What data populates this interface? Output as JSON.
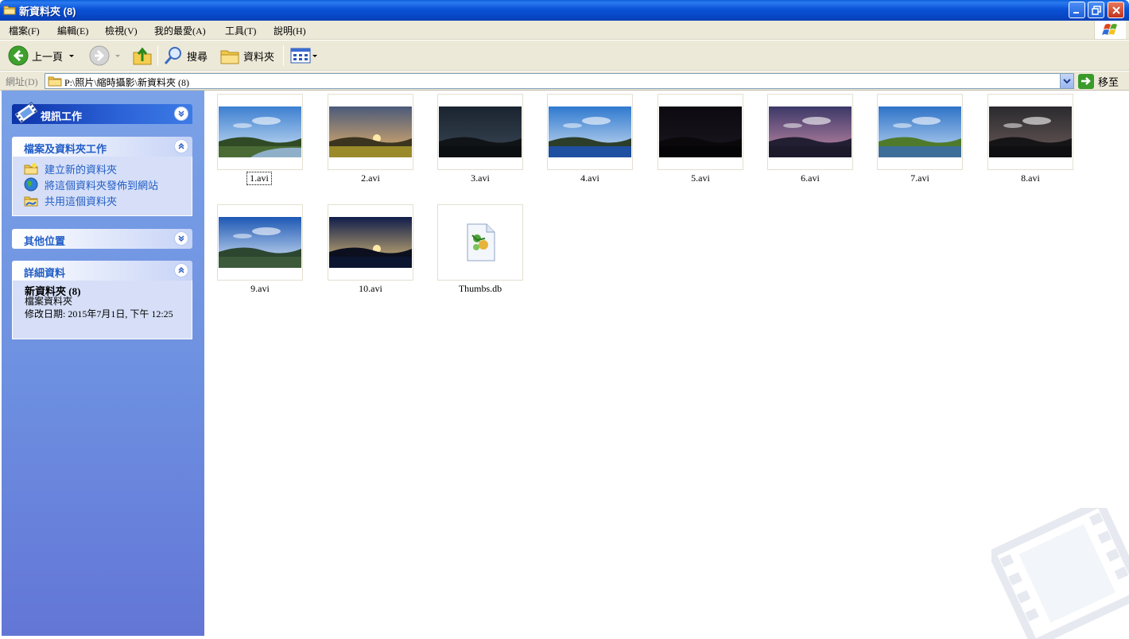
{
  "window": {
    "title": "新資料夾 (8)"
  },
  "menu": [
    {
      "label": "檔案(F)"
    },
    {
      "label": "編輯(E)"
    },
    {
      "label": "檢視(V)"
    },
    {
      "label": "我的最愛(A)"
    },
    {
      "label": "工具(T)"
    },
    {
      "label": "說明(H)"
    }
  ],
  "toolbar": {
    "back_label": "上一頁",
    "search_label": "搜尋",
    "folders_label": "資料夾"
  },
  "address": {
    "label": "網址(D)",
    "path": "P:\\照片\\縮時攝影\\新資料夾 (8)",
    "go_label": "移至"
  },
  "taskpane": {
    "video_tasks": {
      "title": "視訊工作"
    },
    "file_tasks": {
      "title": "檔案及資料夾工作",
      "items": [
        {
          "label": "建立新的資料夾",
          "icon": "new-folder-icon"
        },
        {
          "label": "將這個資料夾發佈到網站",
          "icon": "publish-web-icon"
        },
        {
          "label": "共用這個資料夾",
          "icon": "share-folder-icon"
        }
      ]
    },
    "other_places": {
      "title": "其他位置"
    },
    "details": {
      "title": "詳細資料",
      "name": "新資料夾 (8)",
      "type": "檔案資料夾",
      "modified": "修改日期: 2015年7月1日, 下午 12:25"
    }
  },
  "files": [
    {
      "name": "1.avi",
      "thumb": "mountain-river"
    },
    {
      "name": "2.avi",
      "thumb": "sunset-field"
    },
    {
      "name": "3.avi",
      "thumb": "night-sky"
    },
    {
      "name": "4.avi",
      "thumb": "blue-sky-sea"
    },
    {
      "name": "5.avi",
      "thumb": "dark-night"
    },
    {
      "name": "6.avi",
      "thumb": "purple-dusk"
    },
    {
      "name": "7.avi",
      "thumb": "coast-day"
    },
    {
      "name": "8.avi",
      "thumb": "cloudy-night"
    },
    {
      "name": "9.avi",
      "thumb": "blue-streak-sky"
    },
    {
      "name": "10.avi",
      "thumb": "sunrise-sea"
    },
    {
      "name": "Thumbs.db",
      "thumb": "thumbs-db-icon"
    }
  ],
  "colors": {
    "titlebar": "#0a52d6",
    "taskpane": "#6d8fe0",
    "link": "#215dc6"
  }
}
